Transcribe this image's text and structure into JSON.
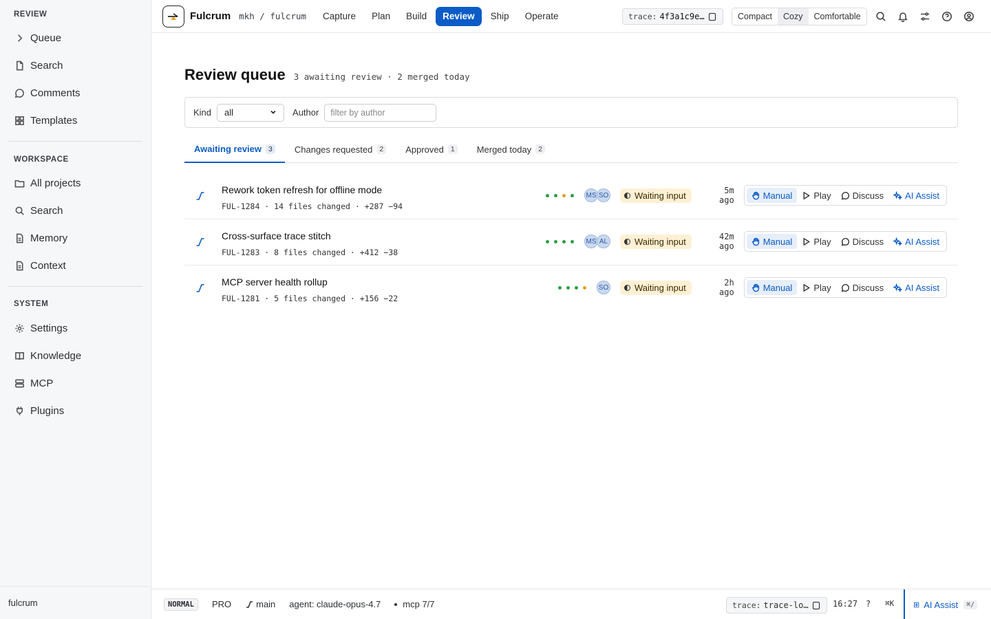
{
  "sidebar": {
    "sections": [
      {
        "title": "REVIEW",
        "items": [
          {
            "label": "Queue",
            "icon": "chevron-right-icon"
          },
          {
            "label": "Search",
            "icon": "document-icon"
          },
          {
            "label": "Comments",
            "icon": "comment-icon"
          },
          {
            "label": "Templates",
            "icon": "grid-icon"
          }
        ]
      },
      {
        "title": "WORKSPACE",
        "items": [
          {
            "label": "All projects",
            "icon": "folder-icon"
          },
          {
            "label": "Search",
            "icon": "search-icon"
          },
          {
            "label": "Memory",
            "icon": "document-icon"
          },
          {
            "label": "Context",
            "icon": "document-icon"
          }
        ]
      },
      {
        "title": "SYSTEM",
        "items": [
          {
            "label": "Settings",
            "icon": "gear-icon"
          },
          {
            "label": "Knowledge",
            "icon": "book-icon"
          },
          {
            "label": "MCP",
            "icon": "server-icon"
          },
          {
            "label": "Plugins",
            "icon": "plug-icon"
          }
        ]
      }
    ],
    "footer": "fulcrum"
  },
  "header": {
    "brand": "Fulcrum",
    "repo": "mkh / fulcrum",
    "nav": [
      "Capture",
      "Plan",
      "Build",
      "Review",
      "Ship",
      "Operate"
    ],
    "active_nav": "Review",
    "trace_key": "trace:",
    "trace_value": "4f3a1c9e…",
    "density": [
      "Compact",
      "Cozy",
      "Comfortable"
    ],
    "density_selected": "Cozy",
    "accent": "#0b5cc7"
  },
  "main": {
    "title": "Review queue",
    "subtitle": "3 awaiting review · 2 merged today",
    "filters": {
      "kind_label": "Kind",
      "kind_value": "all",
      "author_label": "Author",
      "author_placeholder": "filter by author"
    },
    "tabs": [
      {
        "label": "Awaiting review",
        "count": "3"
      },
      {
        "label": "Changes requested",
        "count": "2"
      },
      {
        "label": "Approved",
        "count": "1"
      },
      {
        "label": "Merged today",
        "count": "2"
      }
    ],
    "rows": [
      {
        "title": "Rework token refresh for offline mode",
        "meta": "FUL-1284 · 14 files changed · +287 −94",
        "dots": [
          "#2e9e44",
          "#2e9e44",
          "#e0a21b",
          "#2e9e44"
        ],
        "avatars": [
          "MS",
          "SO"
        ],
        "status": "Waiting input",
        "time": "5m ago"
      },
      {
        "title": "Cross-surface trace stitch",
        "meta": "FUL-1283 · 8 files changed · +412 −38",
        "dots": [
          "#2e9e44",
          "#2e9e44",
          "#2e9e44",
          "#2e9e44"
        ],
        "avatars": [
          "MS",
          "AL"
        ],
        "status": "Waiting input",
        "time": "42m ago"
      },
      {
        "title": "MCP server health rollup",
        "meta": "FUL-1281 · 5 files changed · +156 −22",
        "dots": [
          "#2e9e44",
          "#2e9e44",
          "#2e9e44",
          "#e0a21b"
        ],
        "avatars": [
          "SO"
        ],
        "status": "Waiting input",
        "time": "2h ago"
      }
    ],
    "row_actions": [
      "Manual",
      "Play",
      "Discuss",
      "AI Assist"
    ]
  },
  "statusbar": {
    "mode": "NORMAL",
    "plan": "PRO",
    "branch": "main",
    "agent": "agent: claude-opus-4.7",
    "mcp": "mcp 7/7",
    "trace_key": "trace:",
    "trace_value": "trace-lo…",
    "clock": "16:27",
    "help": "?",
    "cmdk": "⌘K",
    "ai_label": "AI Assist",
    "ai_kbd": "⌘/"
  }
}
